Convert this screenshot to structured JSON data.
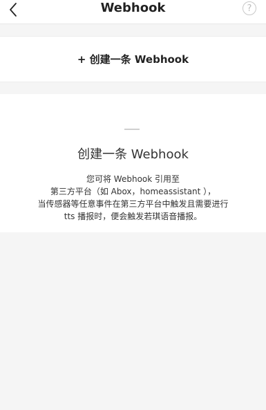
{
  "header": {
    "title": "Webhook",
    "back_icon": "chevron-left-icon",
    "help_icon": "question-circle-icon",
    "help_glyph": "?"
  },
  "create": {
    "label": "+ 创建一条 Webhook"
  },
  "empty_state": {
    "title": "创建一条 Webhook",
    "lines": [
      "您可将 Webhook 引用至",
      "第三方平台（如 Abox，homeassistant ），",
      "当传感器等任意事件在第三方平台中触发且需要进行",
      "tts 播报时，便会触发若琪语音播报。"
    ]
  },
  "colors": {
    "background": "#f5f5f5",
    "card": "#ffffff",
    "text": "#222222",
    "muted": "#bdbdbd"
  }
}
